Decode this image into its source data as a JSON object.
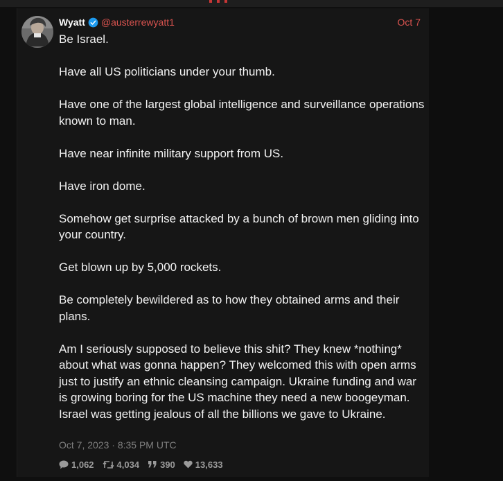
{
  "tweet": {
    "author_name": "Wyatt",
    "handle": "@austerrewyatt1",
    "date": "Oct 7",
    "paragraphs": [
      "Be Israel.",
      "Have all US politicians under your thumb.",
      "Have one of the largest global intelligence and surveillance operations known to man.",
      "Have near infinite military support from US.",
      "Have iron dome.",
      "Somehow get surprise attacked by a bunch of brown men gliding into your country.",
      "Get blown up by 5,000 rockets.",
      "Be completely bewildered as to how they obtained arms and their plans.",
      "Am I seriously supposed to believe this shit? They knew *nothing* about what was gonna happen? They welcomed this with open arms just to justify an ethnic cleansing campaign. Ukraine funding and war is growing boring for the US machine they need a new boogeyman. Israel was getting jealous of all the billions we gave to Ukraine."
    ],
    "timestamp": "Oct 7, 2023 · 8:35 PM UTC",
    "stats": {
      "replies": "1,062",
      "retweets": "4,034",
      "quotes": "390",
      "likes": "13,633"
    }
  },
  "icons": {
    "verified": "verified-badge-icon",
    "replies": "comment-icon",
    "retweets": "retweet-icon",
    "quotes": "quote-icon",
    "likes": "heart-icon"
  },
  "colors": {
    "background": "#0f0f0f",
    "card": "#161616",
    "accent": "#d9534f",
    "text": "#f2f2f2",
    "muted": "#7f7f7f",
    "verified": "#1d9bf0"
  }
}
